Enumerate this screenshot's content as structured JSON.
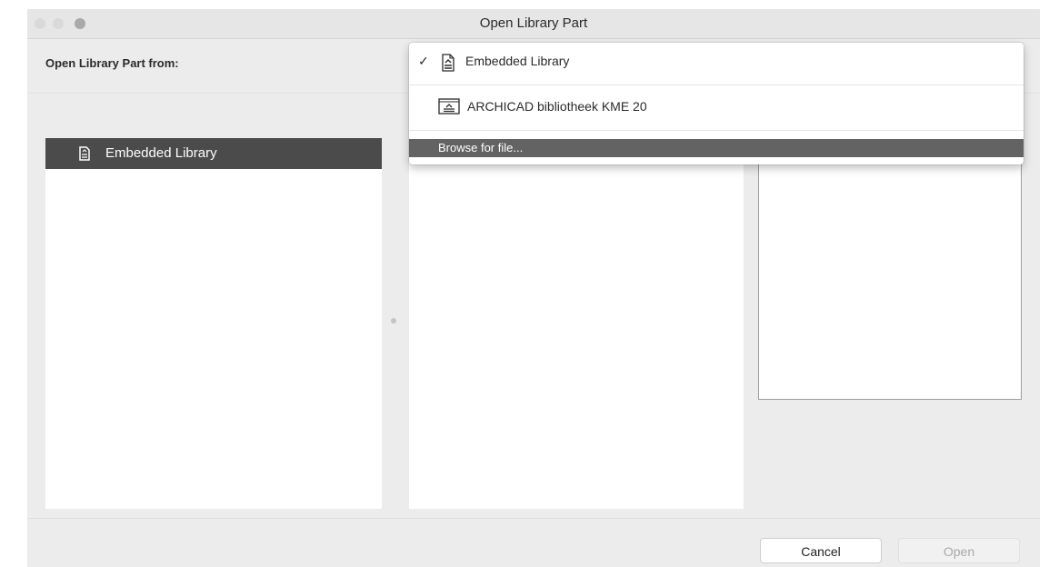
{
  "window": {
    "title": "Open Library Part"
  },
  "source": {
    "label": "Open Library Part from:"
  },
  "library_list": {
    "items": [
      {
        "label": "Embedded Library",
        "icon": "document-icon",
        "selected": true
      }
    ]
  },
  "dropdown": {
    "items": [
      {
        "label": "Embedded Library",
        "icon": "library-document-icon",
        "checked": true
      },
      {
        "label": "ARCHICAD bibliotheek KME 20",
        "icon": "library-folder-icon",
        "checked": false
      },
      {
        "label": "Browse for file...",
        "highlighted": true
      }
    ],
    "check_mark": "✓"
  },
  "buttons": {
    "cancel": "Cancel",
    "open": "Open"
  },
  "colors": {
    "selection": "#4b4b4b",
    "menu_highlight": "#636363"
  }
}
